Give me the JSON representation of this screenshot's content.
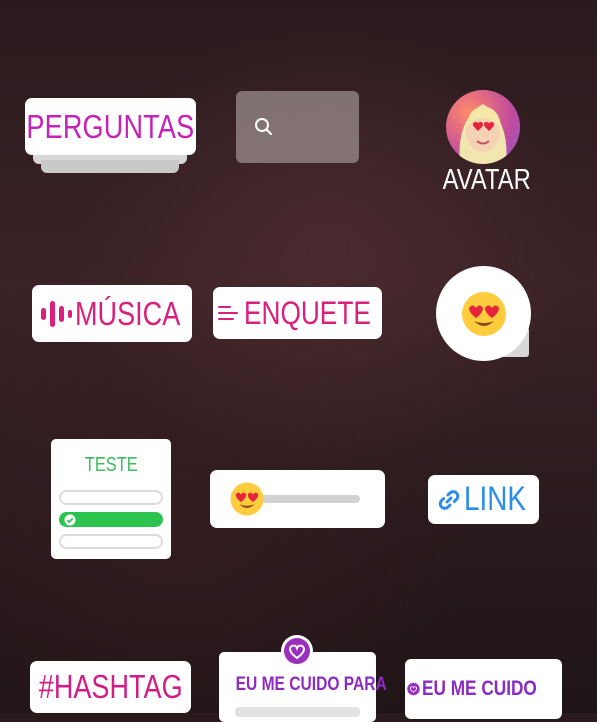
{
  "stickers": {
    "perguntas": "PERGUNTAS",
    "avatar": "AVATAR",
    "musica": "MÚSICA",
    "enquete": "ENQUETE",
    "teste": "TESTE",
    "link": "LINK",
    "hashtag": "#HASHTAG",
    "eu_me_cuido_para": "EU ME CUIDO PARA",
    "eu_me_cuido": "EU ME CUIDO"
  },
  "icons": {
    "search": "search-icon",
    "music": "music-bars-icon",
    "poll": "poll-lines-icon",
    "emoji": "heart-eyes-emoji-icon",
    "link": "link-icon",
    "check": "check-icon",
    "heart_badge": "heart-badge-icon"
  },
  "colors": {
    "perguntas": "#c522b7",
    "pink": "#d9207e",
    "quiz_green": "#2cc34f",
    "link_blue": "#2b8de8",
    "purple": "#8c2bc0"
  }
}
